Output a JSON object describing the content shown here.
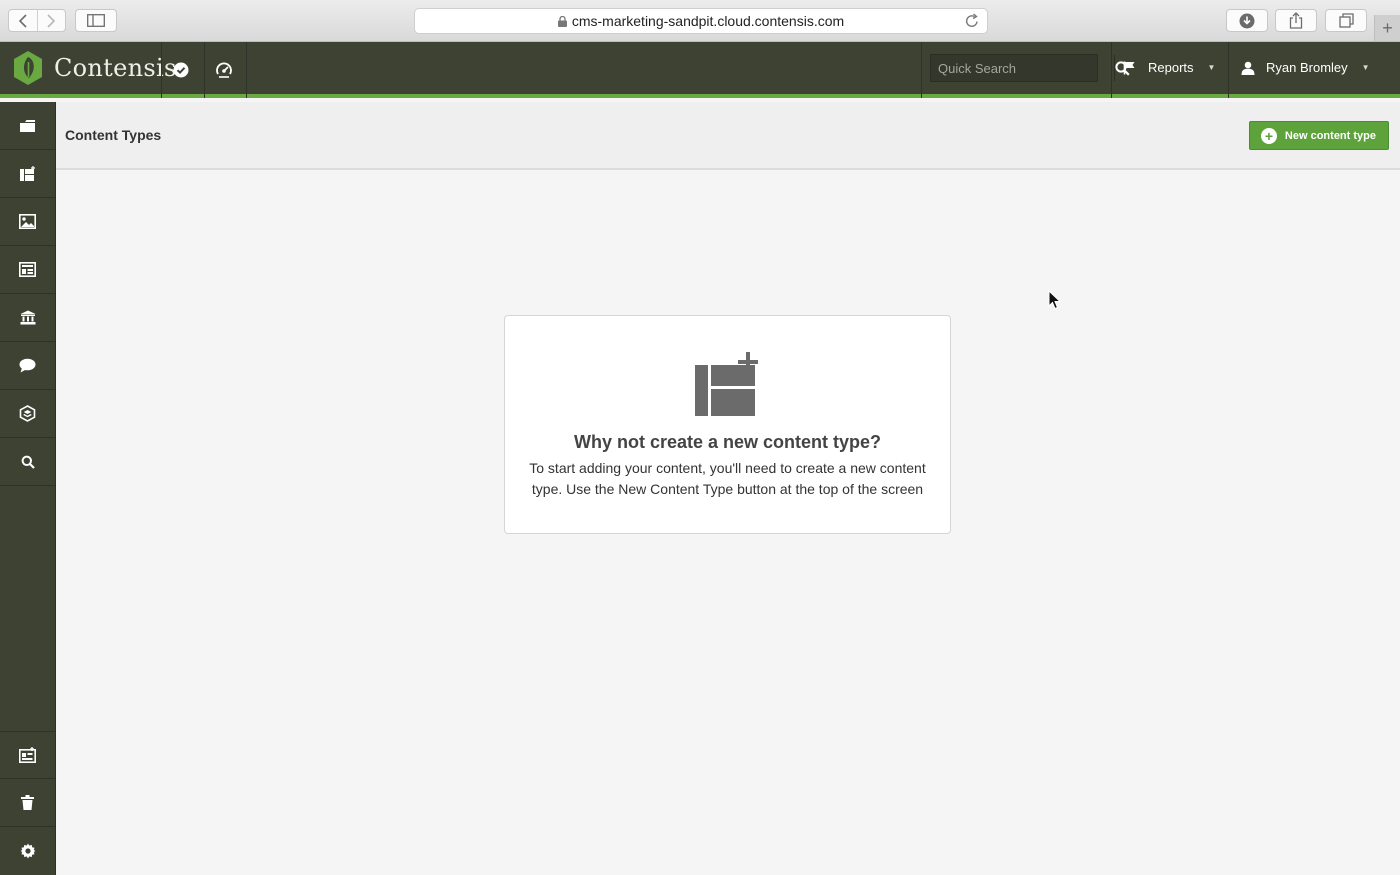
{
  "browser": {
    "url": "cms-marketing-sandpit.cloud.contensis.com",
    "icons": [
      "back-icon",
      "forward-icon",
      "sidebar-icon",
      "lock-icon",
      "reload-icon",
      "download-icon",
      "share-icon",
      "tabs-icon",
      "new-tab-icon"
    ]
  },
  "header": {
    "brand": "Contensis",
    "search_placeholder": "Quick Search",
    "reports_label": "Reports",
    "user_name": "Ryan Bromley"
  },
  "leftnav": {
    "items": [
      "folder-icon",
      "content-types-icon",
      "image-icon",
      "layout-icon",
      "institution-icon",
      "comment-icon",
      "layers-icon",
      "search-icon",
      "calendar-add-icon",
      "trash-icon",
      "settings-icon"
    ]
  },
  "page": {
    "title": "Content Types",
    "new_button_label": "New content type"
  },
  "empty_state": {
    "title": "Why not create a new content type?",
    "text": "To start adding your content, you'll need to create a new content type. Use the New Content Type button at the top of the screen"
  },
  "colors": {
    "header_bg": "#3e4233",
    "accent_green": "#6aa842",
    "button_green": "#5ea23c"
  }
}
